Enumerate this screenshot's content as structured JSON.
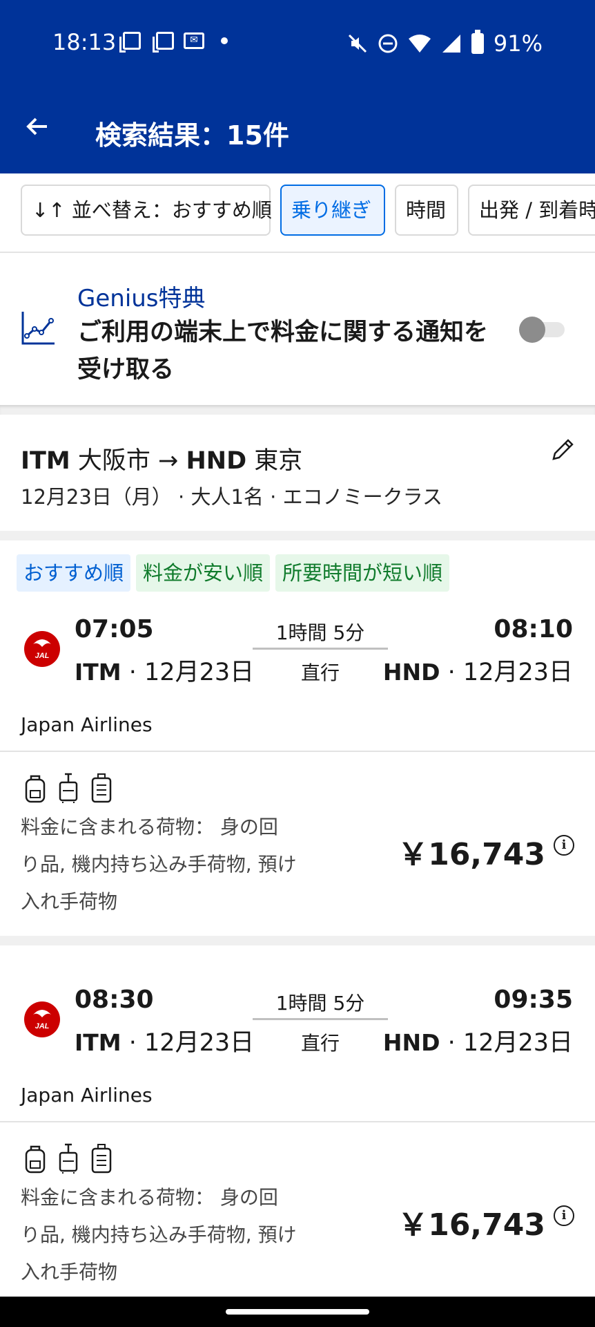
{
  "status_bar": {
    "time": "18:13",
    "battery": "91%",
    "icons": [
      "copy-icon",
      "copy-icon",
      "outlook-icon",
      "dot-icon",
      "mute-icon",
      "dnd-icon",
      "wifi-icon",
      "signal-icon",
      "battery-icon"
    ]
  },
  "header": {
    "title": "検索結果：15件",
    "back_icon": "arrow-left-icon",
    "background": "#003399"
  },
  "filters": {
    "sort": "↓↑ 並べ替え：おすすめ順",
    "transfers": "乗り継ぎ",
    "time": "時間",
    "dep_arr": "出発 / 到着時"
  },
  "genius": {
    "title": "Genius特典",
    "text": "ご利用の端末上で料金に関する通知を受け取る",
    "toggle_on": false
  },
  "search_summary": {
    "from_code": "ITM",
    "from_city": "大阪市",
    "arrow": "→",
    "to_code": "HND",
    "to_city": "東京",
    "details": "12月23日（月） · 大人1名 · エコノミークラス"
  },
  "tags": [
    "おすすめ順",
    "料金が安い順",
    "所要時間が短い順"
  ],
  "flights": [
    {
      "dep_time": "07:05",
      "dep_airport": "ITM",
      "dep_date": "· 12月23日",
      "duration": "1時間 5分",
      "stops": "直行",
      "arr_time": "08:10",
      "arr_airport": "HND",
      "arr_date": "· 12月23日",
      "airline": "Japan Airlines",
      "baggage": "料金に含まれる荷物： 身の回り品, 機内持ち込み手荷物, 預け入れ手荷物",
      "price": "￥16,743"
    },
    {
      "dep_time": "08:30",
      "dep_airport": "ITM",
      "dep_date": "· 12月23日",
      "duration": "1時間 5分",
      "stops": "直行",
      "arr_time": "09:35",
      "arr_airport": "HND",
      "arr_date": "· 12月23日",
      "airline": "Japan Airlines",
      "baggage": "料金に含まれる荷物： 身の回り品, 機内持ち込み手荷物, 預け入れ手荷物",
      "price": "￥16,743"
    }
  ],
  "colors": {
    "brand": "#003399",
    "accent": "#006ce4",
    "jal_red": "#cc0000"
  }
}
